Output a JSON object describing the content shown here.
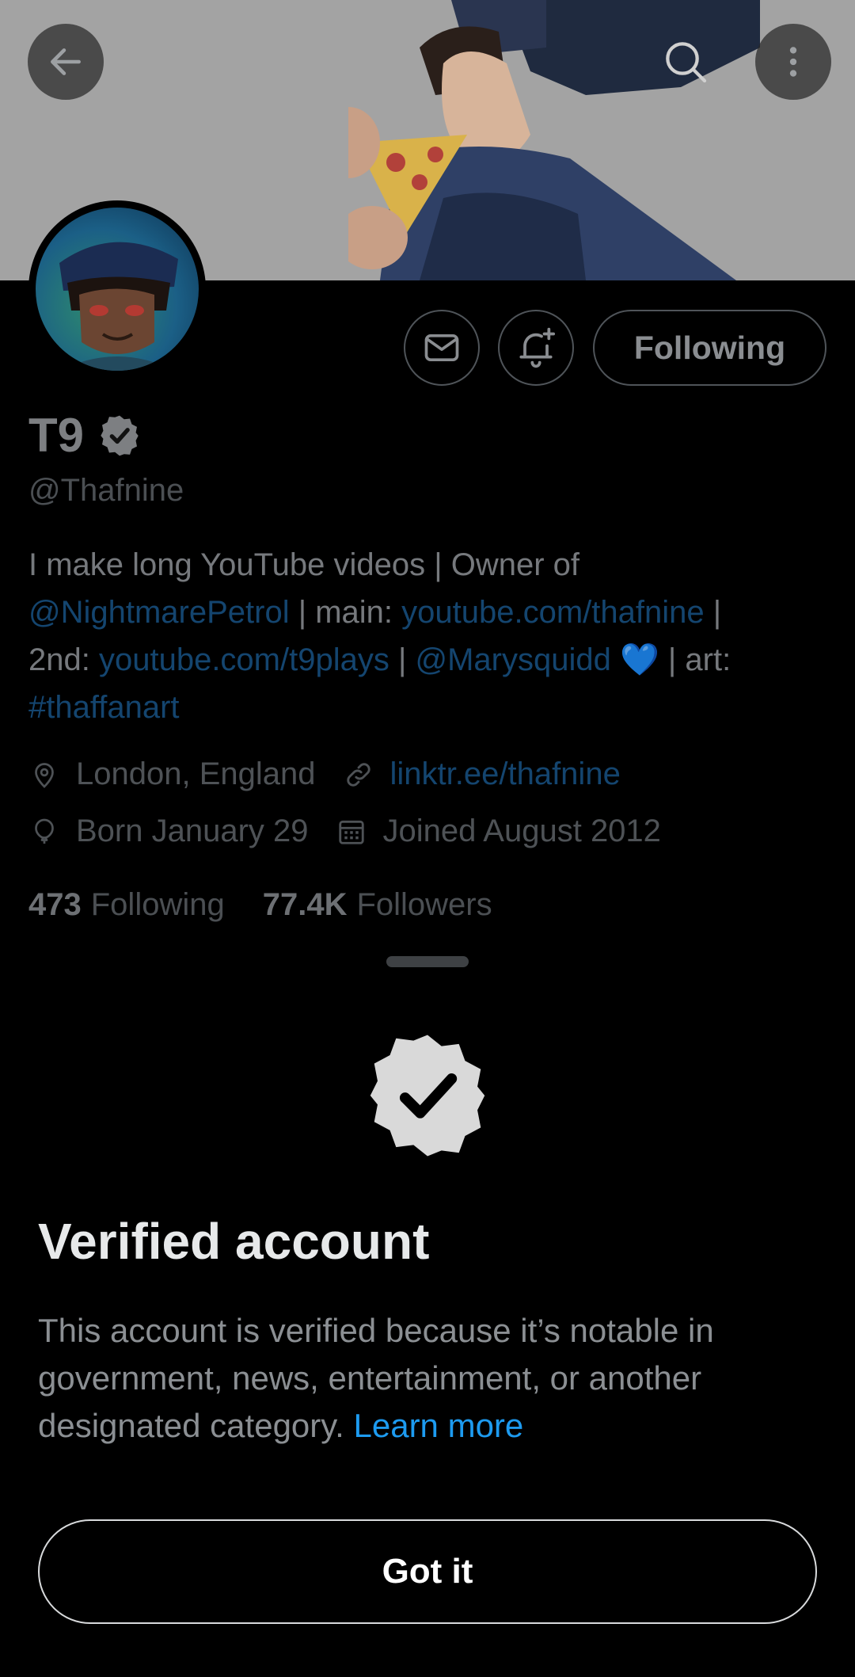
{
  "profile": {
    "display_name": "T9",
    "handle": "@Thafnine",
    "following_button": "Following",
    "bio": {
      "line1": "I make long YouTube videos | Owner of",
      "mention1": "@NightmarePetrol",
      "sep1": " | main: ",
      "link_main": "youtube.com/thafnine",
      "sep2": " |",
      "prefix2": "2nd: ",
      "link_second": "youtube.com/t9plays",
      "sep3": " | ",
      "mention2": "@Marysquidd",
      "heart": "💙",
      "art_label": " | art:",
      "hashtag": "#thaffanart"
    },
    "location": "London, England",
    "website": "linktr.ee/thafnine",
    "birthday": "Born January 29",
    "joined": "Joined August 2012",
    "following_count": "473",
    "following_label": "Following",
    "followers_count": "77.4K",
    "followers_label": "Followers"
  },
  "icons": {
    "back": "arrow-left-icon",
    "search": "search-icon",
    "more": "more-vertical-icon",
    "mail": "mail-icon",
    "bell": "bell-plus-icon",
    "verified": "verified-badge-icon",
    "location": "location-pin-icon",
    "link": "link-icon",
    "birthday": "balloon-icon",
    "calendar": "calendar-icon"
  },
  "sheet": {
    "title": "Verified account",
    "body": "This account is verified because it’s notable in government, news, entertainment, or another designated category.",
    "learn_more": "Learn more",
    "button": "Got it"
  },
  "colors": {
    "background": "#000000",
    "accent_link": "#1d9bf0",
    "dim_link": "#14456f",
    "banner": "#a3a3a3"
  }
}
